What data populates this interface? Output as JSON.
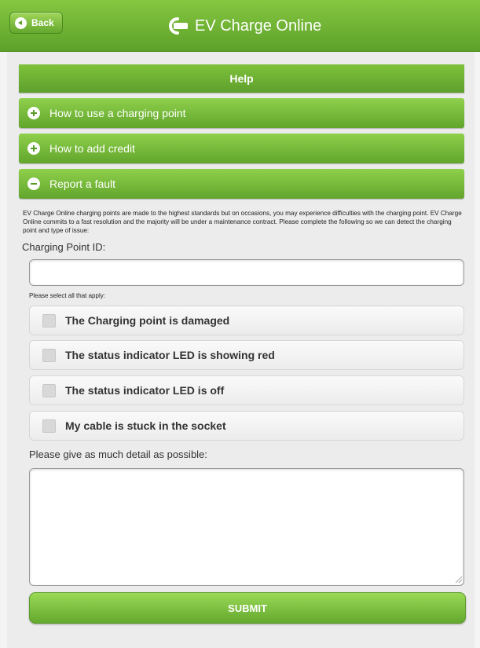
{
  "header": {
    "back_label": "Back",
    "app_title": "EV Charge Online"
  },
  "help": {
    "title": "Help",
    "sections": [
      {
        "label": "How to use a charging point",
        "state": "collapsed",
        "icon": "plus-icon"
      },
      {
        "label": "How to add credit",
        "state": "collapsed",
        "icon": "plus-icon"
      },
      {
        "label": "Report a fault",
        "state": "expanded",
        "icon": "minus-icon"
      }
    ]
  },
  "fault_form": {
    "intro_text": "EV Charge Online charging points are made to the highest standards but on occasions, you may experience difficulties with the charging point. EV Charge Online commits to a fast resolution and the majority will be under a maintenance contract. Please complete the following so we can detect the charging point and type of issue:",
    "charging_point_label": "Charging Point ID:",
    "charging_point_value": "",
    "select_note": "Please select all that apply:",
    "options": [
      {
        "label": "The Charging point is damaged",
        "checked": false
      },
      {
        "label": "The status indicator LED is showing red",
        "checked": false
      },
      {
        "label": "The status indicator LED is off",
        "checked": false
      },
      {
        "label": "My cable is stuck in the socket",
        "checked": false
      }
    ],
    "detail_label": "Please give as much detail as possible:",
    "detail_value": "",
    "submit_label": "SUBMIT"
  },
  "colors": {
    "brand_green": "#6fb432",
    "dark_green": "#5da12a",
    "page_bg": "#ececec"
  }
}
